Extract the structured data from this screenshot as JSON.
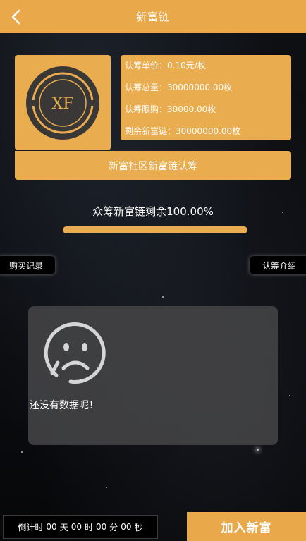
{
  "header": {
    "title": "新富链",
    "back_icon": "chevron-left-icon"
  },
  "info": {
    "logo_text": "XF",
    "unit_price_label": "认筹单价：",
    "unit_price_value": "0.10元/枚",
    "total_label": "认筹总量：",
    "total_value": "30000000.00枚",
    "limit_label": "认筹限购：",
    "limit_value": "30000.00枚",
    "remaining_label": "剩余新富链：",
    "remaining_value": "30000000.00枚",
    "banner": "新富社区新富链认筹"
  },
  "progress": {
    "label": "众筹新富链剩余100.00%",
    "percent": 100
  },
  "buttons": {
    "purchase_records": "购买记录",
    "subscription_intro": "认筹介绍"
  },
  "empty_state": {
    "icon": "sad-face-icon",
    "text": "还没有数据呢！"
  },
  "countdown": {
    "label": "倒计时",
    "days": "00",
    "days_unit": "天",
    "hours": "00",
    "hours_unit": "时",
    "minutes": "00",
    "minutes_unit": "分",
    "seconds": "00",
    "seconds_unit": "秒"
  },
  "join": {
    "label": "加入新富"
  },
  "colors": {
    "accent": "#e9a84a",
    "background": "#0b0c10",
    "panel": "#464648"
  }
}
